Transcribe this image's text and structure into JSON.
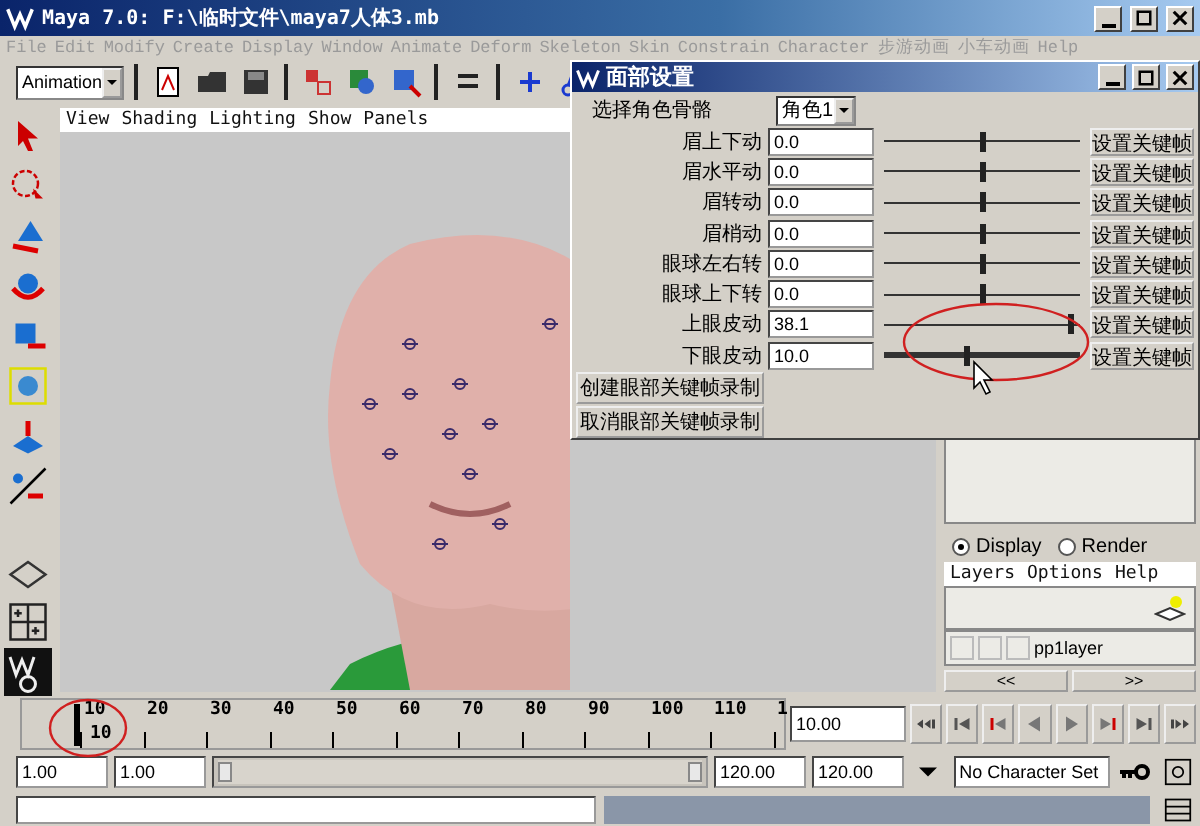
{
  "window": {
    "title": "Maya 7.0: F:\\临时文件\\maya7人体3.mb"
  },
  "menu_bar": [
    "File",
    "Edit",
    "Modify",
    "Create",
    "Display",
    "Window",
    "Animate",
    "Deform",
    "Skeleton",
    "Skin",
    "Constrain",
    "Character",
    "步游动画",
    "小车动画",
    "Help"
  ],
  "status_line": {
    "menu_set": "Animation"
  },
  "viewport": {
    "menu": [
      "View",
      "Shading",
      "Lighting",
      "Show",
      "Panels"
    ]
  },
  "face_dialog": {
    "title": "面部设置",
    "rig_label": "选择角色骨骼",
    "rig_value": "角色1",
    "sliders": [
      {
        "label": "眉上下动",
        "value": "0.0",
        "level": 0.5,
        "button": "设置关键帧"
      },
      {
        "label": "眉水平动",
        "value": "0.0",
        "level": 0.5,
        "button": "设置关键帧"
      },
      {
        "label": "眉转动",
        "value": "0.0",
        "level": 0.5,
        "button": "设置关键帧"
      },
      {
        "label": "眉梢动",
        "value": "0.0",
        "level": 0.5,
        "button": "设置关键帧"
      },
      {
        "label": "眼球左右转",
        "value": "0.0",
        "level": 0.5,
        "button": "设置关键帧"
      },
      {
        "label": "眼球上下转",
        "value": "0.0",
        "level": 0.5,
        "button": "设置关键帧"
      },
      {
        "label": "上眼皮动",
        "value": "38.1",
        "level": 0.95,
        "button": "设置关键帧"
      },
      {
        "label": "下眼皮动",
        "value": "10.0",
        "level": 0.42,
        "button": "设置关键帧"
      }
    ],
    "buttons": [
      "创建眼部关键帧录制",
      "取消眼部关键帧录制"
    ]
  },
  "layer_editor": {
    "modes": [
      {
        "label": "Display",
        "selected": true
      },
      {
        "label": "Render",
        "selected": false
      }
    ],
    "menu": [
      "Layers",
      "Options",
      "Help"
    ],
    "layers": [
      {
        "name": "pp1layer"
      }
    ]
  },
  "channel_box_nav": [
    "<<",
    ">>"
  ],
  "time_slider": {
    "ticks": [
      "10",
      "20",
      "30",
      "40",
      "50",
      "60",
      "70",
      "80",
      "90",
      "100",
      "110",
      "1"
    ],
    "current_frame": "10",
    "level": 0.076,
    "current_time": "10.00"
  },
  "range_slider": {
    "start": "1.00",
    "playback_start": "1.00",
    "playback_end": "120.00",
    "end": "120.00",
    "character_set": "No Character Set",
    "level": 1
  }
}
